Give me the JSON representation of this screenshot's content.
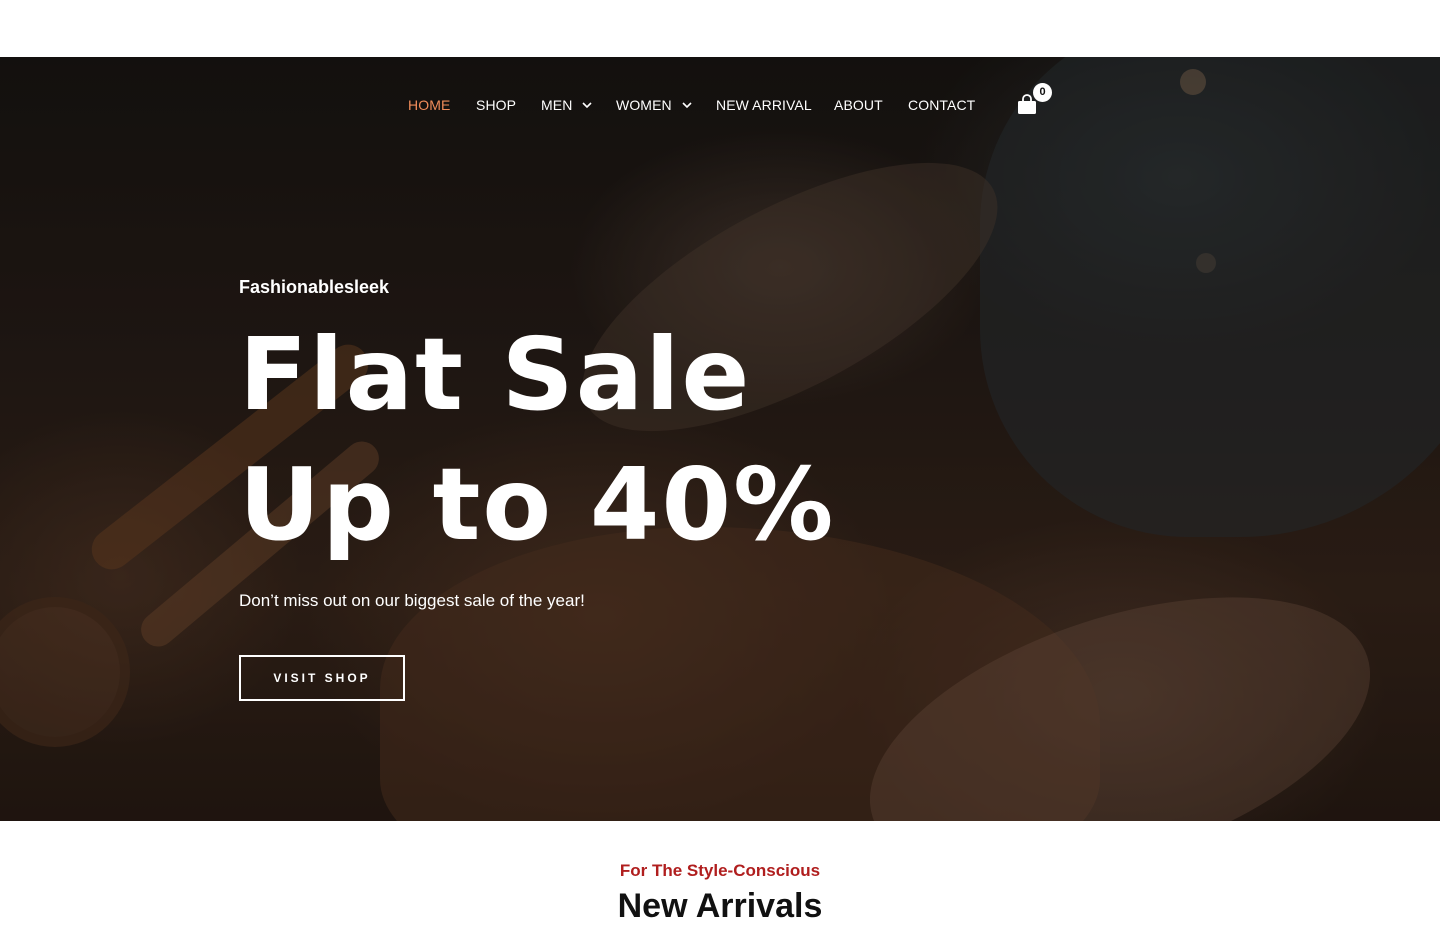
{
  "nav": {
    "items": [
      {
        "label": "HOME",
        "active": true
      },
      {
        "label": "SHOP"
      },
      {
        "label": "MEN",
        "dropdown": true
      },
      {
        "label": "WOMEN",
        "dropdown": true
      },
      {
        "label": "NEW ARRIVAL"
      },
      {
        "label": "ABOUT"
      },
      {
        "label": "CONTACT"
      }
    ],
    "cart_icon": "shopping-bag-icon",
    "cart_count": "0",
    "dropdown_icon": "chevron-down-icon"
  },
  "hero": {
    "brand": "Fashionablesleek",
    "headline_line1": "Flat Sale",
    "headline_line2": "Up to 40%",
    "subtext": "Don’t miss out on our biggest sale of the year!",
    "cta_label": "VISIT SHOP"
  },
  "section": {
    "eyebrow": "For The Style-Conscious",
    "title": "New Arrivals"
  },
  "colors": {
    "active_nav": "#f08c5a",
    "eyebrow": "#b01e1e"
  }
}
